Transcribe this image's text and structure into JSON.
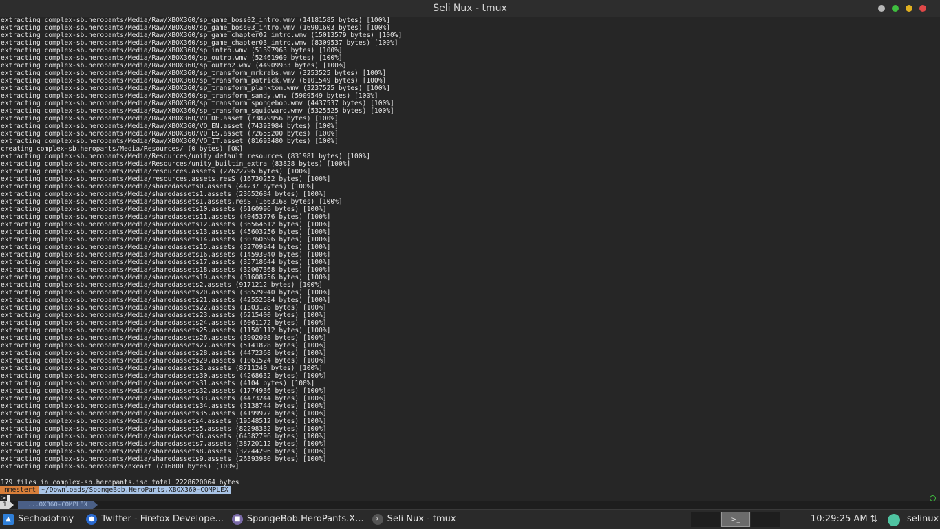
{
  "window": {
    "title": "Seli Nux - tmux"
  },
  "terminal": {
    "lines": [
      "extracting complex-sb.heropants/Media/Raw/XBOX360/sp_game_boss02_intro.wmv (14181585 bytes) [100%]",
      "extracting complex-sb.heropants/Media/Raw/XBOX360/sp_game_boss03_intro.wmv (16901603 bytes) [100%]",
      "extracting complex-sb.heropants/Media/Raw/XBOX360/sp_game_chapter02_intro.wmv (15013579 bytes) [100%]",
      "extracting complex-sb.heropants/Media/Raw/XBOX360/sp_game_chapter03_intro.wmv (8309537 bytes) [100%]",
      "extracting complex-sb.heropants/Media/Raw/XBOX360/sp_intro.wmv (51397963 bytes) [100%]",
      "extracting complex-sb.heropants/Media/Raw/XBOX360/sp_outro.wmv (52461969 bytes) [100%]",
      "extracting complex-sb.heropants/Media/Raw/XBOX360/sp_outro2.wmv (44909933 bytes) [100%]",
      "extracting complex-sb.heropants/Media/Raw/XBOX360/sp_transform_mrkrabs.wmv (3253525 bytes) [100%]",
      "extracting complex-sb.heropants/Media/Raw/XBOX360/sp_transform_patrick.wmv (6101549 bytes) [100%]",
      "extracting complex-sb.heropants/Media/Raw/XBOX360/sp_transform_plankton.wmv (3237525 bytes) [100%]",
      "extracting complex-sb.heropants/Media/Raw/XBOX360/sp_transform_sandy.wmv (5909549 bytes) [100%]",
      "extracting complex-sb.heropants/Media/Raw/XBOX360/sp_transform_spongebob.wmv (4437537 bytes) [100%]",
      "extracting complex-sb.heropants/Media/Raw/XBOX360/sp_transform_squidward.wmv (5325525 bytes) [100%]",
      "extracting complex-sb.heropants/Media/Raw/XBOX360/VO_DE.asset (73879956 bytes) [100%]",
      "extracting complex-sb.heropants/Media/Raw/XBOX360/VO_EN.asset (74393984 bytes) [100%]",
      "extracting complex-sb.heropants/Media/Raw/XBOX360/VO_ES.asset (72655200 bytes) [100%]",
      "extracting complex-sb.heropants/Media/Raw/XBOX360/VO_IT.asset (81693480 bytes) [100%]",
      "creating complex-sb.heropants/Media/Resources/ (0 bytes) [OK]",
      "extracting complex-sb.heropants/Media/Resources/unity default resources (831981 bytes) [100%]",
      "extracting complex-sb.heropants/Media/Resources/unity_builtin_extra (83828 bytes) [100%]",
      "extracting complex-sb.heropants/Media/resources.assets (27622796 bytes) [100%]",
      "extracting complex-sb.heropants/Media/resources.assets.resS (16730252 bytes) [100%]",
      "extracting complex-sb.heropants/Media/sharedassets0.assets (44237 bytes) [100%]",
      "extracting complex-sb.heropants/Media/sharedassets1.assets (23652684 bytes) [100%]",
      "extracting complex-sb.heropants/Media/sharedassets1.assets.resS (1663168 bytes) [100%]",
      "extracting complex-sb.heropants/Media/sharedassets10.assets (6160996 bytes) [100%]",
      "extracting complex-sb.heropants/Media/sharedassets11.assets (40453776 bytes) [100%]",
      "extracting complex-sb.heropants/Media/sharedassets12.assets (36564612 bytes) [100%]",
      "extracting complex-sb.heropants/Media/sharedassets13.assets (45603256 bytes) [100%]",
      "extracting complex-sb.heropants/Media/sharedassets14.assets (30760696 bytes) [100%]",
      "extracting complex-sb.heropants/Media/sharedassets15.assets (32709944 bytes) [100%]",
      "extracting complex-sb.heropants/Media/sharedassets16.assets (14593940 bytes) [100%]",
      "extracting complex-sb.heropants/Media/sharedassets17.assets (35718644 bytes) [100%]",
      "extracting complex-sb.heropants/Media/sharedassets18.assets (32067368 bytes) [100%]",
      "extracting complex-sb.heropants/Media/sharedassets19.assets (31608756 bytes) [100%]",
      "extracting complex-sb.heropants/Media/sharedassets2.assets (9171212 bytes) [100%]",
      "extracting complex-sb.heropants/Media/sharedassets20.assets (38529940 bytes) [100%]",
      "extracting complex-sb.heropants/Media/sharedassets21.assets (42552584 bytes) [100%]",
      "extracting complex-sb.heropants/Media/sharedassets22.assets (1303128 bytes) [100%]",
      "extracting complex-sb.heropants/Media/sharedassets23.assets (6215400 bytes) [100%]",
      "extracting complex-sb.heropants/Media/sharedassets24.assets (6061172 bytes) [100%]",
      "extracting complex-sb.heropants/Media/sharedassets25.assets (11501112 bytes) [100%]",
      "extracting complex-sb.heropants/Media/sharedassets26.assets (3902008 bytes) [100%]",
      "extracting complex-sb.heropants/Media/sharedassets27.assets (5141828 bytes) [100%]",
      "extracting complex-sb.heropants/Media/sharedassets28.assets (4472368 bytes) [100%]",
      "extracting complex-sb.heropants/Media/sharedassets29.assets (1061524 bytes) [100%]",
      "extracting complex-sb.heropants/Media/sharedassets3.assets (8711240 bytes) [100%]",
      "extracting complex-sb.heropants/Media/sharedassets30.assets (4268632 bytes) [100%]",
      "extracting complex-sb.heropants/Media/sharedassets31.assets (4104 bytes) [100%]",
      "extracting complex-sb.heropants/Media/sharedassets32.assets (1774936 bytes) [100%]",
      "extracting complex-sb.heropants/Media/sharedassets33.assets (4473244 bytes) [100%]",
      "extracting complex-sb.heropants/Media/sharedassets34.assets (3138744 bytes) [100%]",
      "extracting complex-sb.heropants/Media/sharedassets35.assets (4199972 bytes) [100%]",
      "extracting complex-sb.heropants/Media/sharedassets4.assets (19548512 bytes) [100%]",
      "extracting complex-sb.heropants/Media/sharedassets5.assets (82298332 bytes) [100%]",
      "extracting complex-sb.heropants/Media/sharedassets6.assets (64582796 bytes) [100%]",
      "extracting complex-sb.heropants/Media/sharedassets7.assets (38720112 bytes) [100%]",
      "extracting complex-sb.heropants/Media/sharedassets8.assets (32244296 bytes) [100%]",
      "extracting complex-sb.heropants/Media/sharedassets9.assets (26393980 bytes) [100%]",
      "extracting complex-sb.heropants/nxeart (716800 bytes) [100%]"
    ],
    "summary": "179 files in complex-sb.heropants.iso total 2228620064 bytes",
    "prompt_user": "nmestert",
    "prompt_path": "~/Downloads/SpongeBob.HeroPants.XBOX360-COMPLEX",
    "cursor_prefix": ">"
  },
  "tmux": {
    "window_index": "1",
    "window_name": "...OX360-COMPLEX"
  },
  "taskbar": {
    "start_label": "Sechodotmy",
    "tasks": [
      {
        "label": "Twitter - Firefox Develope...",
        "icon": "firefox-icon"
      },
      {
        "label": "SpongeBob.HeroPants.X...",
        "icon": "folder-icon"
      },
      {
        "label": "Seli Nux - tmux",
        "icon": "terminal-icon"
      }
    ],
    "active_workspace_glyph": ">_",
    "clock": "10:29:25 AM",
    "net_glyph": "⇅",
    "username": "selinux"
  },
  "colors": {
    "prompt_user_bg": "#d87f3a",
    "prompt_path_bg": "#a9c4e6",
    "tmux_window_bg": "#4a5f86"
  }
}
